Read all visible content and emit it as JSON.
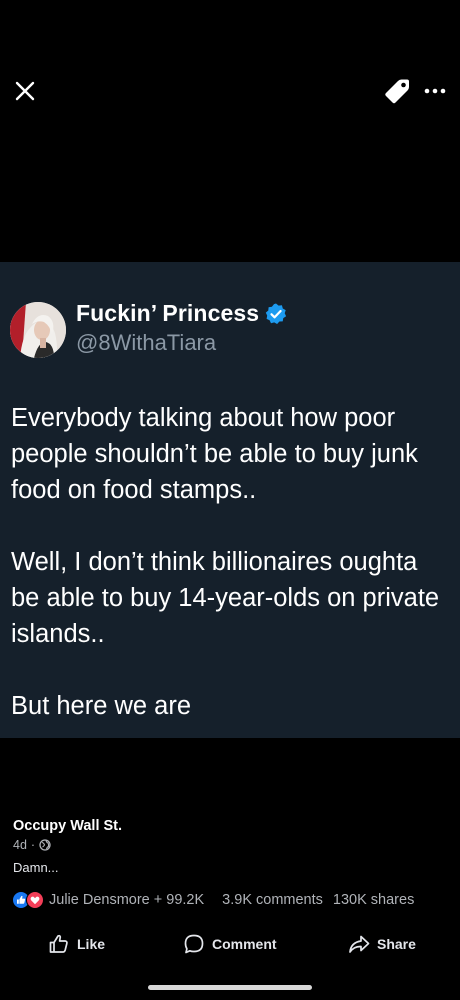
{
  "tweet": {
    "display_name": "Fuckin’ Princess",
    "handle": "@8WithaTiara",
    "text": "Everybody talking about how poor people shouldn’t be able to buy junk food on food stamps..\n\nWell, I don’t think billionaires oughta be able to buy 14-year-olds on private islands..\n\nBut here we are",
    "verified_color": "#1d9bf0",
    "card_bg": "#15202b"
  },
  "post": {
    "page_name": "Occupy Wall St.",
    "time": "4d",
    "separator": "·",
    "audience_icon": "globe-icon",
    "caption": "Damn..."
  },
  "engagement": {
    "reactors": "Julie Densmore + 99.2K",
    "comments": "3.9K comments",
    "shares": "130K shares",
    "reaction_icons": [
      "like-reaction-icon",
      "love-reaction-icon"
    ]
  },
  "actions": {
    "like": "Like",
    "comment": "Comment",
    "share": "Share"
  },
  "toolbar": {
    "icons": [
      "close-icon",
      "tag-icon",
      "more-icon"
    ]
  }
}
